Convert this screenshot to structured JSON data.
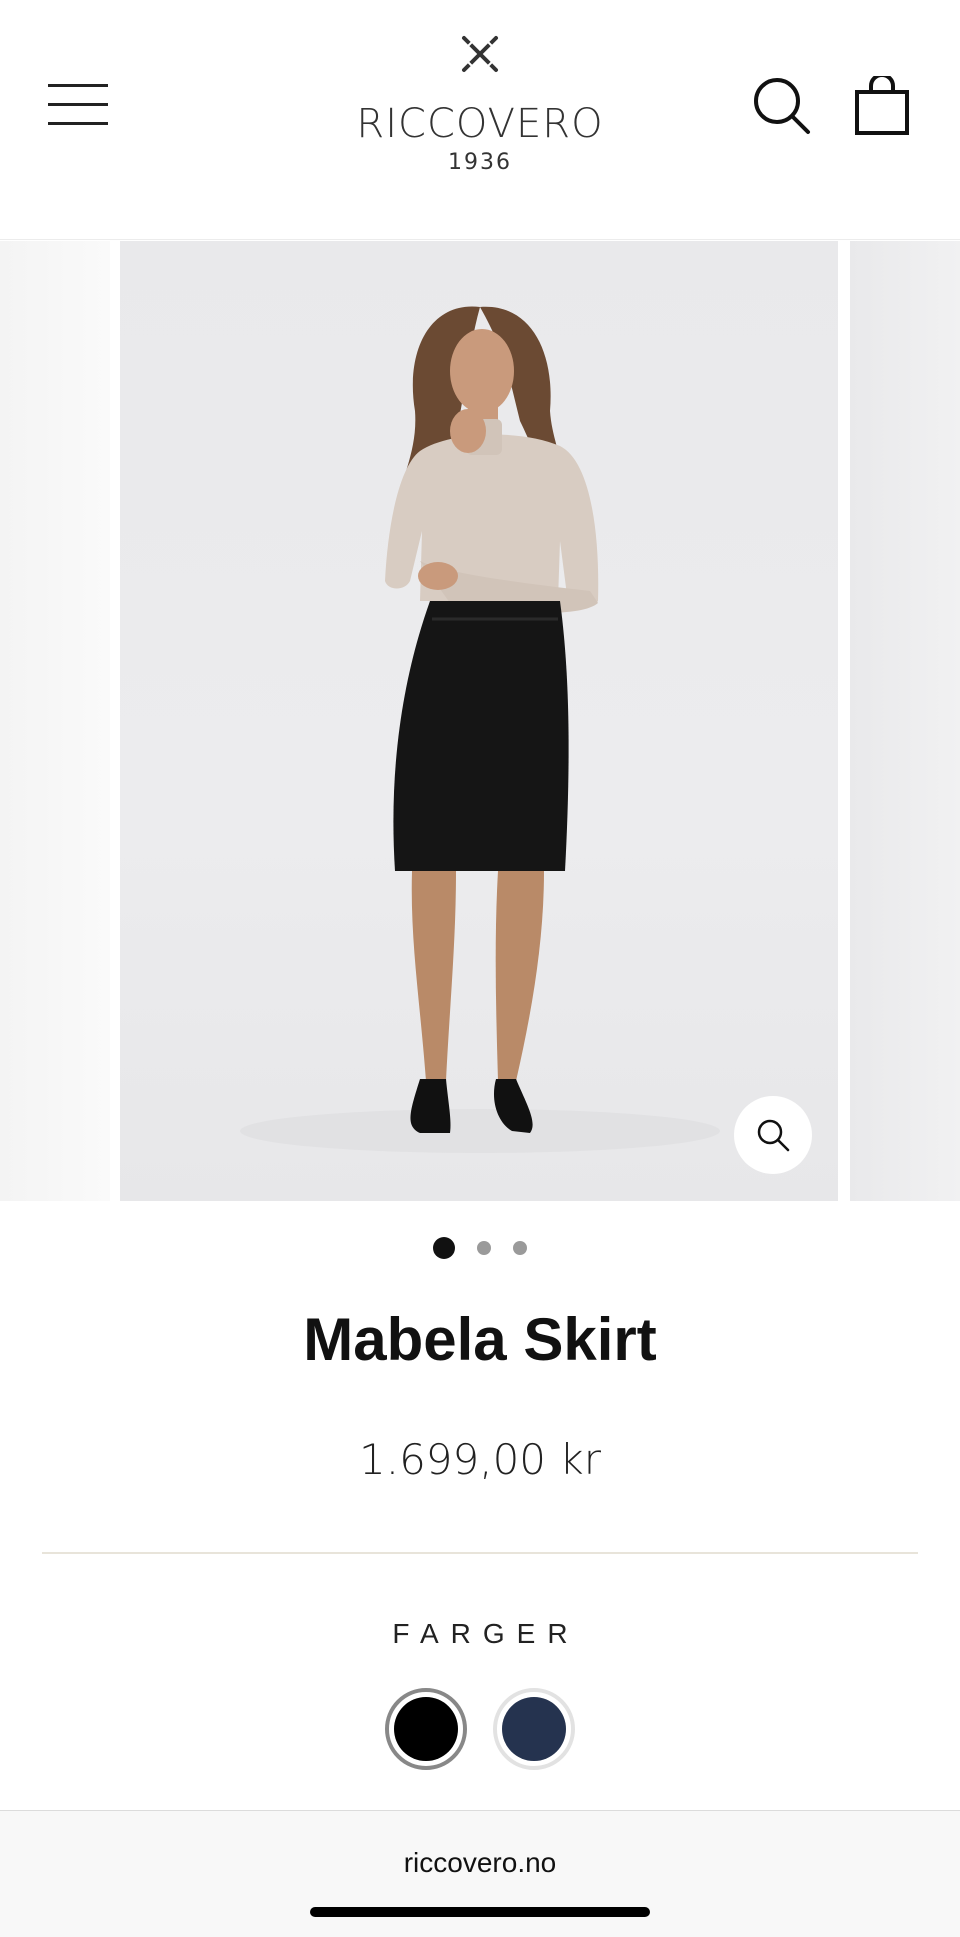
{
  "header": {
    "menu_icon": "hamburger-menu-icon",
    "brand_name": "RICCOVERO",
    "brand_year": "1936",
    "search_icon": "search-icon",
    "cart_icon": "shopping-bag-icon"
  },
  "carousel": {
    "zoom_icon": "zoom-icon",
    "dots_count": 3,
    "active_dot": 1
  },
  "product": {
    "title": "Mabela Skirt",
    "price": "1.699,00 kr"
  },
  "colors": {
    "label": "FARGER",
    "swatches": [
      {
        "name": "black",
        "color": "#000000",
        "selected": true
      },
      {
        "name": "navy",
        "color": "#25334f",
        "selected": false
      }
    ]
  },
  "browser": {
    "url": "riccovero.no"
  }
}
